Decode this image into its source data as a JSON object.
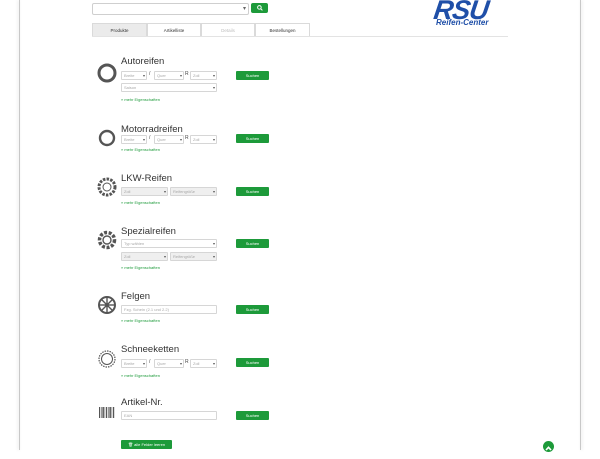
{
  "logo": {
    "main": "RSU",
    "sub": "Reifen-Center"
  },
  "tabs": [
    {
      "label": "Produkte"
    },
    {
      "label": "Artikelliste"
    },
    {
      "label": "Details"
    },
    {
      "label": "Bestellungen"
    }
  ],
  "common": {
    "search_label": "Suchen",
    "more_label": "» mehr Eigenschaften"
  },
  "sections": {
    "autoreifen": {
      "title": "Autoreifen",
      "breite": "Breite",
      "quer": "Quer",
      "zoll": "Zoll",
      "saison": "Saison"
    },
    "motorradreifen": {
      "title": "Motorradreifen",
      "breite": "Breite",
      "quer": "Quer",
      "zoll": "Zoll"
    },
    "lkw": {
      "title": "LKW-Reifen",
      "zoll": "Zoll",
      "reifengroesse": "Reifengröße"
    },
    "spezialreifen": {
      "title": "Spezialreifen",
      "typ": "Typ wählen",
      "zoll": "Zoll",
      "reifengroesse": "Reifengröße"
    },
    "felgen": {
      "title": "Felgen",
      "placeholder": "Fzg. Schein (2.1 und 2.2)"
    },
    "schneeketten": {
      "title": "Schneeketten",
      "breite": "Breite",
      "quer": "Quer",
      "zoll": "Zoll"
    },
    "artikel": {
      "title": "Artikel-Nr.",
      "placeholder": "EAN"
    }
  },
  "clear_label": "alle Felder leeren",
  "colors": {
    "accent": "#1d9a3a",
    "logo": "#1f4fa8"
  }
}
